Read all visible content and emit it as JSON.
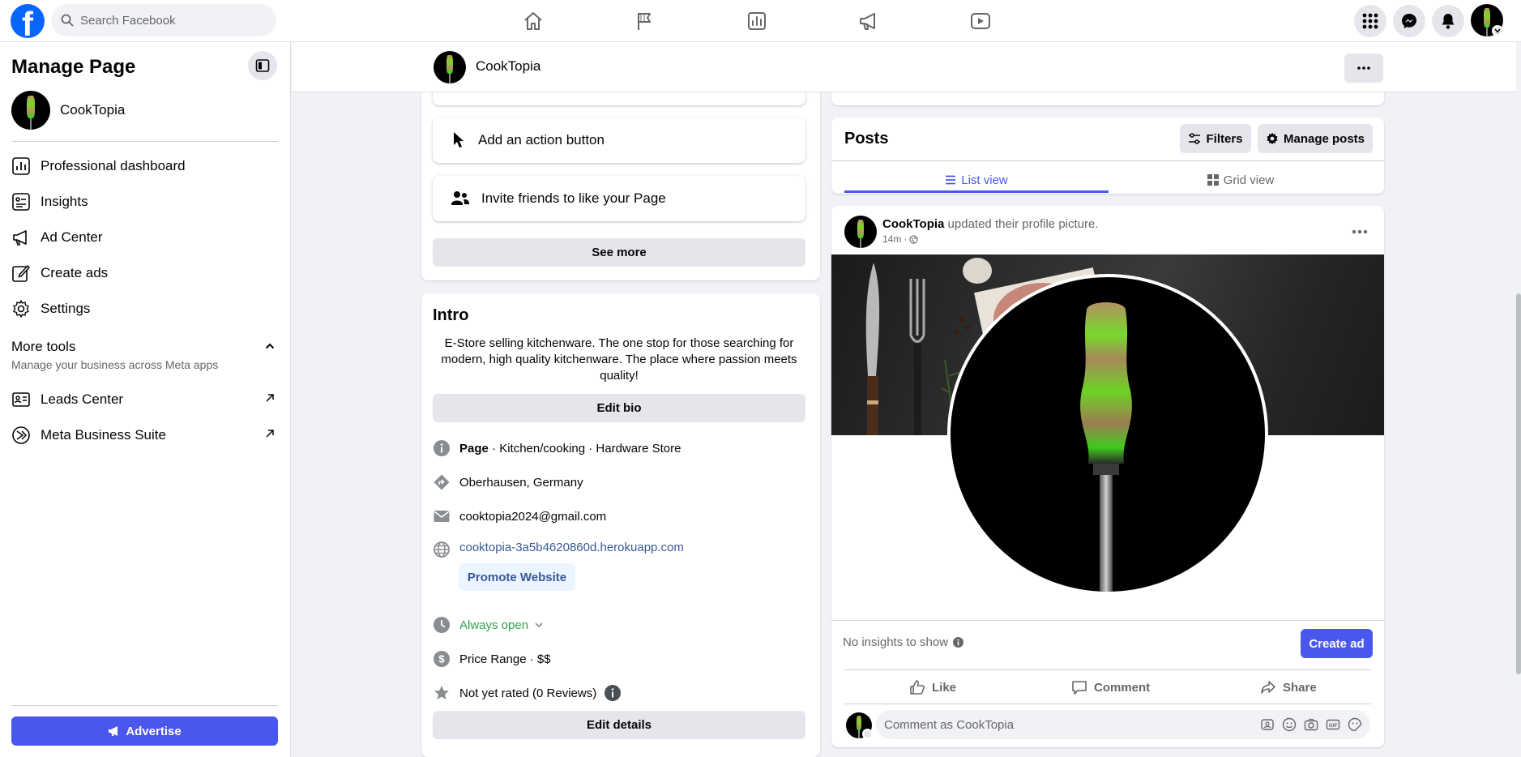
{
  "colors": {
    "brand": "#0866ff",
    "primary_button": "#4a57ed",
    "link": "#385898",
    "open_status": "#31a24c",
    "muted_text": "#65676b"
  },
  "topbar": {
    "search_placeholder": "Search Facebook",
    "nav_icons": [
      "home-icon",
      "flag-icon",
      "insights-chart-icon",
      "megaphone-icon",
      "video-icon"
    ],
    "right_icons": [
      "menu-grid-icon",
      "messenger-icon",
      "notifications-bell-icon",
      "profile-avatar"
    ]
  },
  "sidebar": {
    "title": "Manage Page",
    "page_name": "CookTopia",
    "items": [
      {
        "label": "Professional dashboard",
        "icon": "dashboard-icon"
      },
      {
        "label": "Insights",
        "icon": "insights-icon"
      },
      {
        "label": "Ad Center",
        "icon": "megaphone-icon"
      },
      {
        "label": "Create ads",
        "icon": "edit-icon"
      },
      {
        "label": "Settings",
        "icon": "gear-icon"
      }
    ],
    "more_tools": {
      "title": "More tools",
      "subtitle": "Manage your business across Meta apps"
    },
    "tools": [
      {
        "label": "Leads Center",
        "icon": "leads-icon"
      },
      {
        "label": "Meta Business Suite",
        "icon": "meta-business-icon"
      }
    ],
    "advertise_label": "Advertise"
  },
  "header": {
    "page_name": "CookTopia"
  },
  "left_column": {
    "action_button_label": "Add an action button",
    "invite_label": "Invite friends to like your Page",
    "see_more_label": "See more"
  },
  "intro": {
    "title": "Intro",
    "bio": "E-Store selling kitchenware. The one stop for those searching for modern, high quality kitchenware. The place where passion meets quality!",
    "edit_bio_label": "Edit bio",
    "category_prefix": "Page",
    "category": " · Kitchen/cooking · Hardware Store",
    "location": "Oberhausen, Germany",
    "email": "cooktopia2024@gmail.com",
    "website": "cooktopia-3a5b4620860d.herokuapp.com",
    "promote_label": "Promote Website",
    "hours": "Always open",
    "price": "Price Range · $$",
    "rating": "Not yet rated (0 Reviews)",
    "edit_details_label": "Edit details"
  },
  "posts": {
    "title": "Posts",
    "filters_label": "Filters",
    "manage_label": "Manage posts",
    "tabs": [
      {
        "label": "List view",
        "active": true
      },
      {
        "label": "Grid view",
        "active": false
      }
    ]
  },
  "post": {
    "author": "CookTopia",
    "action": " updated their profile picture.",
    "time": "14m",
    "no_insights": "No insights to show",
    "create_ad_label": "Create ad",
    "like_label": "Like",
    "comment_label": "Comment",
    "share_label": "Share",
    "comment_placeholder": "Comment as CookTopia"
  }
}
